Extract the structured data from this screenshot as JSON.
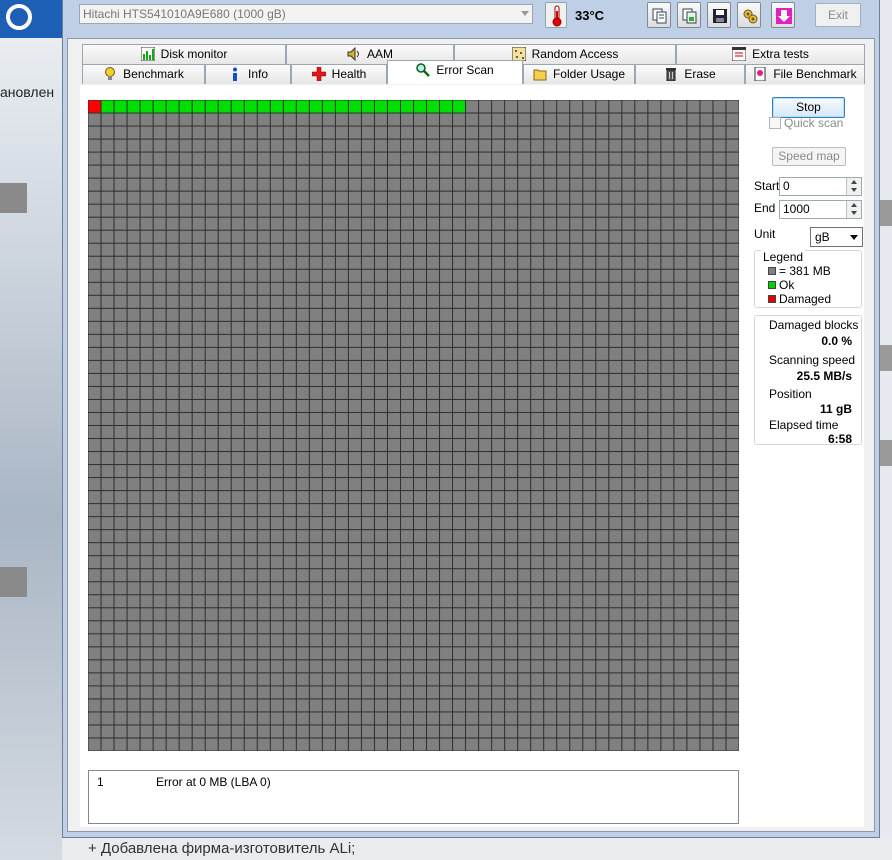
{
  "background": {
    "left_text": "ановлен",
    "bottom_text": "+ Добавлена фирма-изготовитель ALi;"
  },
  "toolbar": {
    "drive": "Hitachi HTS541010A9E680  (1000 gB)",
    "temperature": "33°C",
    "exit_label": "Exit",
    "buttons": [
      "copy-text-icon",
      "copy-image-icon",
      "save-icon",
      "options-icon",
      "download-icon"
    ]
  },
  "tabs_top": [
    {
      "label": "Disk monitor",
      "icon": "chart-icon"
    },
    {
      "label": "AAM",
      "icon": "speaker-icon"
    },
    {
      "label": "Random Access",
      "icon": "random-access-icon"
    },
    {
      "label": "Extra tests",
      "icon": "extra-tests-icon"
    }
  ],
  "tabs_bottom": [
    {
      "label": "Benchmark",
      "icon": "bulb-icon"
    },
    {
      "label": "Info",
      "icon": "info-icon"
    },
    {
      "label": "Health",
      "icon": "health-cross-icon"
    },
    {
      "label": "Error Scan",
      "icon": "magnifier-icon",
      "active": true
    },
    {
      "label": "Folder Usage",
      "icon": "folder-icon"
    },
    {
      "label": "Erase",
      "icon": "trash-icon"
    },
    {
      "label": "File Benchmark",
      "icon": "file-benchmark-icon"
    }
  ],
  "scan": {
    "columns": 50,
    "rows": 50,
    "damaged_blocks": [
      0
    ],
    "ok_count": 29,
    "colors": {
      "unscanned": "#808080",
      "ok": "#00e000",
      "damaged": "#ff0000"
    }
  },
  "controls": {
    "stop_label": "Stop",
    "quick_scan_label": "Quick scan",
    "speed_map_label": "Speed map",
    "start_label": "Start",
    "start_value": "0",
    "end_label": "End",
    "end_value": "1000",
    "unit_label": "Unit",
    "unit_value": "gB"
  },
  "legend": {
    "title": "Legend",
    "block_size": "= 381 MB",
    "ok": "Ok",
    "damaged": "Damaged"
  },
  "stats": {
    "damaged_blocks_label": "Damaged blocks",
    "damaged_blocks_value": "0.0 %",
    "scanning_speed_label": "Scanning speed",
    "scanning_speed_value": "25.5 MB/s",
    "position_label": "Position",
    "position_value": "11 gB",
    "elapsed_label": "Elapsed time",
    "elapsed_value": "6:58"
  },
  "errors": [
    {
      "num": "1",
      "message": "Error at 0 MB (LBA 0)"
    }
  ]
}
